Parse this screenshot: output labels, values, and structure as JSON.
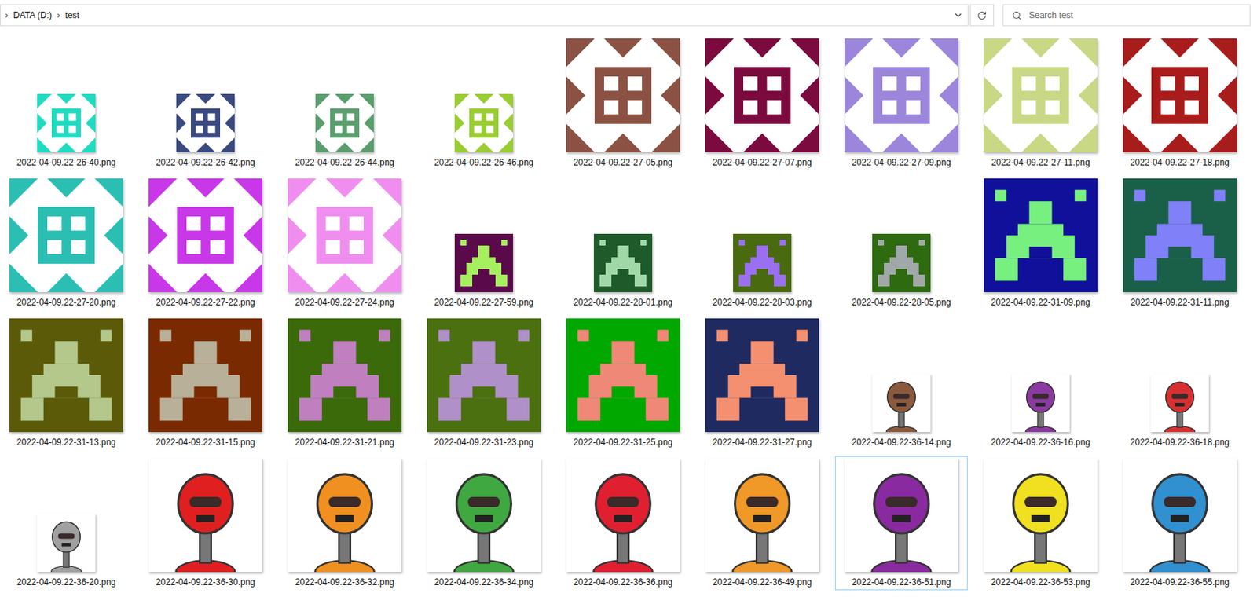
{
  "address_bar": {
    "crumbs": [
      {
        "chevron": "›",
        "label": "DATA (D:)"
      },
      {
        "chevron": "›",
        "label": "test"
      }
    ]
  },
  "search": {
    "placeholder": "Search test"
  },
  "files": [
    {
      "name": "2022-04-09.22-26-40.png",
      "kind": "identicon",
      "large": false,
      "color": "#1fdcc0",
      "background": "#ffffff",
      "selected": false
    },
    {
      "name": "2022-04-09.22-26-42.png",
      "kind": "identicon",
      "large": false,
      "color": "#3a4a80",
      "background": "#ffffff",
      "selected": false
    },
    {
      "name": "2022-04-09.22-26-44.png",
      "kind": "identicon",
      "large": false,
      "color": "#5a9e6e",
      "background": "#ffffff",
      "selected": false
    },
    {
      "name": "2022-04-09.22-26-46.png",
      "kind": "identicon",
      "large": false,
      "color": "#9acd32",
      "background": "#ffffff",
      "selected": false
    },
    {
      "name": "2022-04-09.22-27-05.png",
      "kind": "identicon",
      "large": true,
      "color": "#8b5243",
      "background": "#ffffff",
      "selected": false
    },
    {
      "name": "2022-04-09.22-27-07.png",
      "kind": "identicon",
      "large": true,
      "color": "#7b0a3e",
      "background": "#ffffff",
      "selected": false
    },
    {
      "name": "2022-04-09.22-27-09.png",
      "kind": "identicon",
      "large": true,
      "color": "#9b86dc",
      "background": "#ffffff",
      "selected": false
    },
    {
      "name": "2022-04-09.22-27-11.png",
      "kind": "identicon",
      "large": true,
      "color": "#c8d884",
      "background": "#ffffff",
      "selected": false
    },
    {
      "name": "2022-04-09.22-27-18.png",
      "kind": "identicon",
      "large": true,
      "color": "#a81c1c",
      "background": "#ffffff",
      "selected": false
    },
    {
      "name": "2022-04-09.22-27-20.png",
      "kind": "identicon",
      "large": true,
      "color": "#2bbfb4",
      "background": "#ffffff",
      "selected": false
    },
    {
      "name": "2022-04-09.22-27-22.png",
      "kind": "identicon",
      "large": true,
      "color": "#c837e8",
      "background": "#ffffff",
      "selected": false
    },
    {
      "name": "2022-04-09.22-27-24.png",
      "kind": "identicon",
      "large": true,
      "color": "#f08ef0",
      "background": "#ffffff",
      "selected": false
    },
    {
      "name": "2022-04-09.22-27-59.png",
      "kind": "invader",
      "large": false,
      "color": "#a6f060",
      "background": "#5a0a4a",
      "selected": false
    },
    {
      "name": "2022-04-09.22-28-01.png",
      "kind": "invader",
      "large": false,
      "color": "#a0d8a8",
      "background": "#1e5a2a",
      "selected": false
    },
    {
      "name": "2022-04-09.22-28-03.png",
      "kind": "invader",
      "large": false,
      "color": "#9a70f0",
      "background": "#4a6a10",
      "selected": false
    },
    {
      "name": "2022-04-09.22-28-05.png",
      "kind": "invader",
      "large": false,
      "color": "#a0a8a8",
      "background": "#2e6a10",
      "selected": false
    },
    {
      "name": "2022-04-09.22-31-09.png",
      "kind": "invader",
      "large": true,
      "color": "#78f080",
      "background": "#10109a",
      "selected": false
    },
    {
      "name": "2022-04-09.22-31-11.png",
      "kind": "invader",
      "large": true,
      "color": "#8080f8",
      "background": "#1a6048",
      "selected": false
    },
    {
      "name": "2022-04-09.22-31-13.png",
      "kind": "invader",
      "large": true,
      "color": "#b4c88c",
      "background": "#5a5a08",
      "selected": false
    },
    {
      "name": "2022-04-09.22-31-15.png",
      "kind": "invader",
      "large": true,
      "color": "#b8b098",
      "background": "#7a2a00",
      "selected": false
    },
    {
      "name": "2022-04-09.22-31-21.png",
      "kind": "invader",
      "large": true,
      "color": "#c080c0",
      "background": "#3a6a0a",
      "selected": false
    },
    {
      "name": "2022-04-09.22-31-23.png",
      "kind": "invader",
      "large": true,
      "color": "#b090c8",
      "background": "#4a7010",
      "selected": false
    },
    {
      "name": "2022-04-09.22-31-25.png",
      "kind": "invader",
      "large": true,
      "color": "#f08878",
      "background": "#00a800",
      "selected": false
    },
    {
      "name": "2022-04-09.22-31-27.png",
      "kind": "invader",
      "large": true,
      "color": "#f49070",
      "background": "#1e2a60",
      "selected": false
    },
    {
      "name": "2022-04-09.22-36-14.png",
      "kind": "robot",
      "large": false,
      "color": "#8b5a3c",
      "background": "#ffffff",
      "selected": false
    },
    {
      "name": "2022-04-09.22-36-16.png",
      "kind": "robot",
      "large": false,
      "color": "#8a3aa0",
      "background": "#ffffff",
      "selected": false
    },
    {
      "name": "2022-04-09.22-36-18.png",
      "kind": "robot",
      "large": false,
      "color": "#d83030",
      "background": "#ffffff",
      "selected": false
    },
    {
      "name": "2022-04-09.22-36-20.png",
      "kind": "robot",
      "large": false,
      "color": "#a0a0a0",
      "background": "#ffffff",
      "selected": false
    },
    {
      "name": "2022-04-09.22-36-30.png",
      "kind": "robot",
      "large": true,
      "color": "#e02020",
      "background": "#ffffff",
      "selected": false
    },
    {
      "name": "2022-04-09.22-36-32.png",
      "kind": "robot",
      "large": true,
      "color": "#f09020",
      "background": "#ffffff",
      "selected": false
    },
    {
      "name": "2022-04-09.22-36-34.png",
      "kind": "robot",
      "large": true,
      "color": "#40a840",
      "background": "#ffffff",
      "selected": false
    },
    {
      "name": "2022-04-09.22-36-36.png",
      "kind": "robot",
      "large": true,
      "color": "#e02030",
      "background": "#ffffff",
      "selected": false
    },
    {
      "name": "2022-04-09.22-36-49.png",
      "kind": "robot",
      "large": true,
      "color": "#f09828",
      "background": "#ffffff",
      "selected": false
    },
    {
      "name": "2022-04-09.22-36-51.png",
      "kind": "robot",
      "large": true,
      "color": "#8a2aa0",
      "background": "#ffffff",
      "selected": true
    },
    {
      "name": "2022-04-09.22-36-53.png",
      "kind": "robot",
      "large": true,
      "color": "#f0e020",
      "background": "#ffffff",
      "selected": false
    },
    {
      "name": "2022-04-09.22-36-55.png",
      "kind": "robot",
      "large": true,
      "color": "#3090d0",
      "background": "#ffffff",
      "selected": false
    }
  ]
}
